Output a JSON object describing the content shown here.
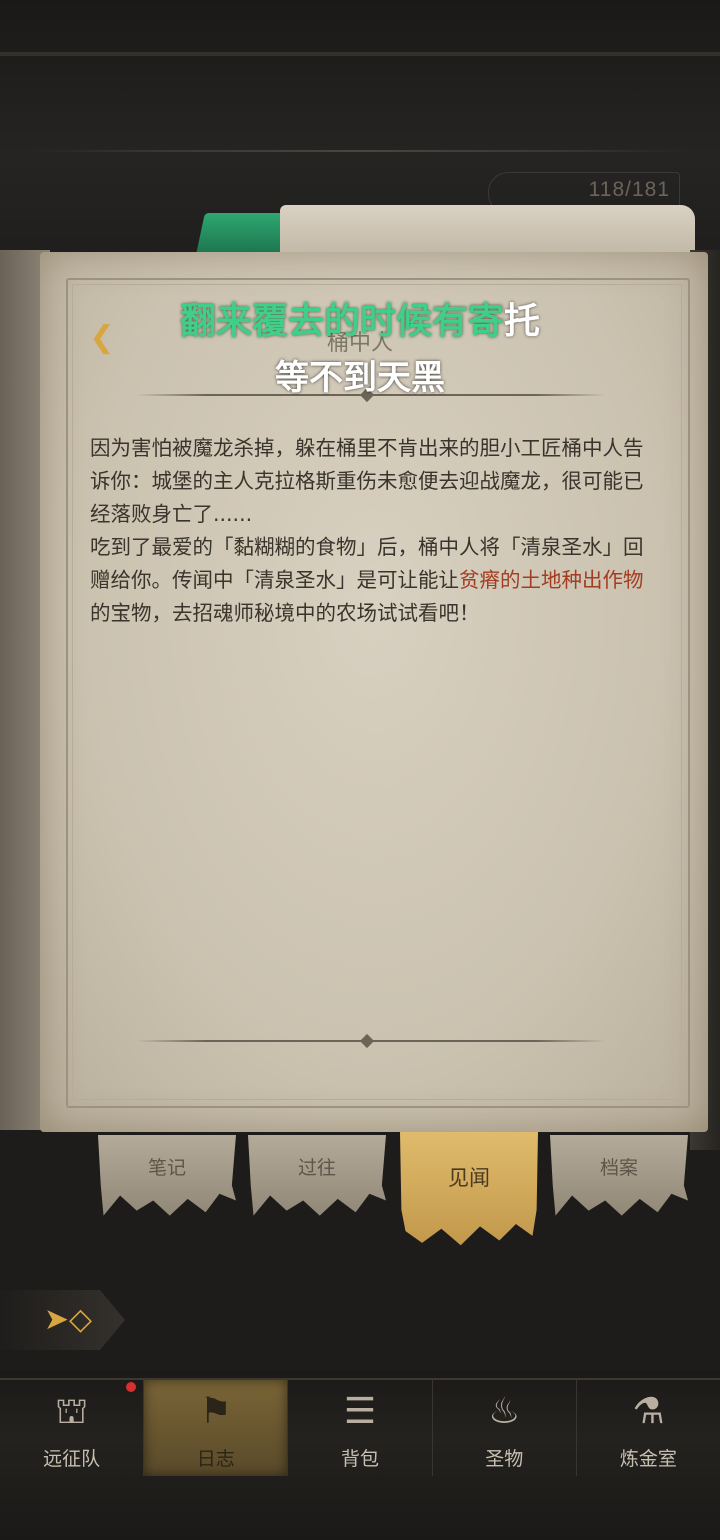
{
  "page_counter": "118/181",
  "subtitle": {
    "line1_green": "翻来覆去的时候有寄",
    "line1_white": "托",
    "line2": "等不到天黑"
  },
  "page_title": "桶中人",
  "story": {
    "p1": "因为害怕被魔龙杀掉，躲在桶里不肯出来的胆小工匠桶中人告诉你：城堡的主人克拉格斯重伤未愈便去迎战魔龙，很可能已经落败身亡了......",
    "p2_a": "吃到了最爱的「黏糊糊的食物」后，桶中人将「清泉圣水」回赠给你。传闻中「清泉圣水」是可让能让",
    "p2_highlight": "贫瘠的土地种出作物",
    "p2_b": "的宝物，去招魂师秘境中的农场试试看吧！"
  },
  "tabs": [
    "笔记",
    "过往",
    "见闻",
    "档案"
  ],
  "active_tab": "见闻",
  "nav": [
    {
      "label": "远征队",
      "icon": "helmet-icon"
    },
    {
      "label": "日志",
      "icon": "journal-icon"
    },
    {
      "label": "背包",
      "icon": "backpack-icon"
    },
    {
      "label": "圣物",
      "icon": "relic-icon"
    },
    {
      "label": "炼金室",
      "icon": "alchemy-icon"
    }
  ],
  "colors": {
    "subtitle_green": "#3fcf86",
    "highlight_red": "#a33d22",
    "accent_gold": "#d8a640"
  }
}
